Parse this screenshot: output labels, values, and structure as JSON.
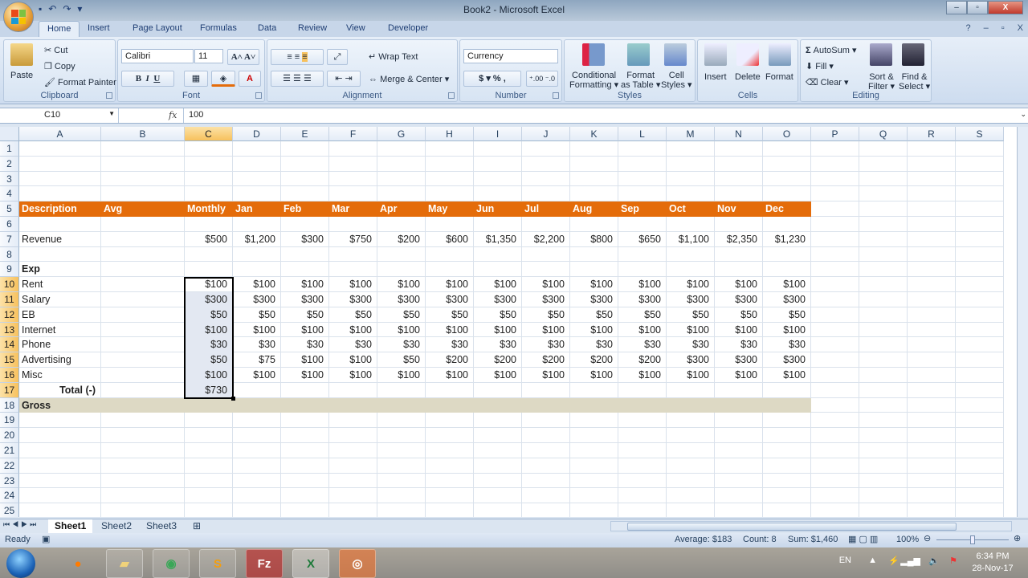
{
  "window": {
    "title": "Book2 - Microsoft Excel",
    "controls": {
      "minimize": "–",
      "restore": "▫",
      "close": "X"
    }
  },
  "quick_access": [
    {
      "name": "save-icon",
      "glyph": "💾"
    },
    {
      "name": "undo-icon",
      "glyph": "↶"
    },
    {
      "name": "redo-icon",
      "glyph": "↷"
    },
    {
      "name": "customize-icon",
      "glyph": "▾"
    }
  ],
  "tabs": [
    "Home",
    "Insert",
    "Page Layout",
    "Formulas",
    "Data",
    "Review",
    "View",
    "Developer"
  ],
  "active_tab": "Home",
  "ribbon": {
    "clipboard": {
      "label": "Clipboard",
      "paste": "Paste",
      "cut": "Cut",
      "copy": "Copy",
      "format_painter": "Format Painter"
    },
    "font": {
      "label": "Font",
      "font_name": "Calibri",
      "font_size": "11",
      "grow": "A",
      "shrink": "A",
      "bold": "B",
      "italic": "I",
      "underline": "U",
      "font_color": "A"
    },
    "alignment": {
      "label": "Alignment",
      "wrap_text": "Wrap Text",
      "merge_center": "Merge & Center"
    },
    "number": {
      "label": "Number",
      "format": "Currency",
      "dollar": "$",
      "percent": "%",
      "comma": ",",
      "inc_dec": ".00",
      "dec_dec": ".0"
    },
    "styles": {
      "label": "Styles",
      "conditional": "Conditional",
      "conditional2": "Formatting",
      "format_table": "Format",
      "format_table2": "as Table",
      "cell_styles": "Cell",
      "cell_styles2": "Styles"
    },
    "cells": {
      "label": "Cells",
      "insert": "Insert",
      "delete": "Delete",
      "format": "Format"
    },
    "editing": {
      "label": "Editing",
      "autosum": "AutoSum",
      "fill": "Fill",
      "clear": "Clear",
      "sort": "Sort &",
      "sort2": "Filter",
      "find": "Find &",
      "find2": "Select"
    }
  },
  "formula_bar": {
    "name_box": "C10",
    "fx": "fx",
    "content": "100"
  },
  "columns": [
    "A",
    "B",
    "C",
    "D",
    "E",
    "F",
    "G",
    "H",
    "I",
    "J",
    "K",
    "L",
    "M",
    "N",
    "O",
    "P",
    "Q",
    "R",
    "S"
  ],
  "selected_column": "C",
  "rows": [
    "1",
    "2",
    "3",
    "4",
    "5",
    "6",
    "7",
    "8",
    "9",
    "10",
    "11",
    "12",
    "13",
    "14",
    "15",
    "16",
    "17",
    "18",
    "19",
    "20",
    "21",
    "22",
    "23",
    "24",
    "25"
  ],
  "sheet": {
    "header_row": [
      "Description",
      "Avg",
      "Monthly",
      "Jan",
      "Feb",
      "Mar",
      "Apr",
      "May",
      "Jun",
      "Jul",
      "Aug",
      "Sep",
      "Oct",
      "Nov",
      "Dec"
    ],
    "revenue": {
      "label": "Revenue",
      "avg": "",
      "values": [
        "$500",
        "$1,200",
        "$300",
        "$750",
        "$200",
        "$600",
        "$1,350",
        "$2,200",
        "$800",
        "$650",
        "$1,100",
        "$2,350",
        "$1,230"
      ]
    },
    "exp_label": "Exp",
    "expenses": [
      {
        "label": "Rent",
        "values": [
          "$100",
          "$100",
          "$100",
          "$100",
          "$100",
          "$100",
          "$100",
          "$100",
          "$100",
          "$100",
          "$100",
          "$100",
          "$100"
        ]
      },
      {
        "label": "Salary",
        "values": [
          "$300",
          "$300",
          "$300",
          "$300",
          "$300",
          "$300",
          "$300",
          "$300",
          "$300",
          "$300",
          "$300",
          "$300",
          "$300"
        ]
      },
      {
        "label": "EB",
        "values": [
          "$50",
          "$50",
          "$50",
          "$50",
          "$50",
          "$50",
          "$50",
          "$50",
          "$50",
          "$50",
          "$50",
          "$50",
          "$50"
        ]
      },
      {
        "label": "Internet",
        "values": [
          "$100",
          "$100",
          "$100",
          "$100",
          "$100",
          "$100",
          "$100",
          "$100",
          "$100",
          "$100",
          "$100",
          "$100",
          "$100"
        ]
      },
      {
        "label": "Phone",
        "values": [
          "$30",
          "$30",
          "$30",
          "$30",
          "$30",
          "$30",
          "$30",
          "$30",
          "$30",
          "$30",
          "$30",
          "$30",
          "$30"
        ]
      },
      {
        "label": "Advertising",
        "values": [
          "$50",
          "$75",
          "$100",
          "$100",
          "$50",
          "$200",
          "$200",
          "$200",
          "$200",
          "$200",
          "$300",
          "$300",
          "$300"
        ]
      },
      {
        "label": "Misc",
        "values": [
          "$100",
          "$100",
          "$100",
          "$100",
          "$100",
          "$100",
          "$100",
          "$100",
          "$100",
          "$100",
          "$100",
          "$100",
          "$100"
        ]
      }
    ],
    "total": {
      "label": "Total (-)",
      "value": "$730"
    },
    "gross_label": "Gross",
    "colors": {
      "header_band": "#e46c0a",
      "gross_band": "#ddd9c4",
      "selection": "#000000"
    }
  },
  "sheet_tabs": [
    "Sheet1",
    "Sheet2",
    "Sheet3"
  ],
  "active_sheet": "Sheet1",
  "status": {
    "ready": "Ready",
    "average": "Average: $183",
    "count": "Count: 8",
    "sum": "Sum: $1,460",
    "zoom": "100%"
  },
  "taskbar": {
    "apps": [
      "Firefox",
      "File Explorer",
      "Chrome",
      "Sublime Text",
      "FileZilla",
      "Excel",
      "Screen Recorder"
    ],
    "lang": "EN",
    "time": "6:34 PM",
    "date": "28-Nov-17"
  }
}
